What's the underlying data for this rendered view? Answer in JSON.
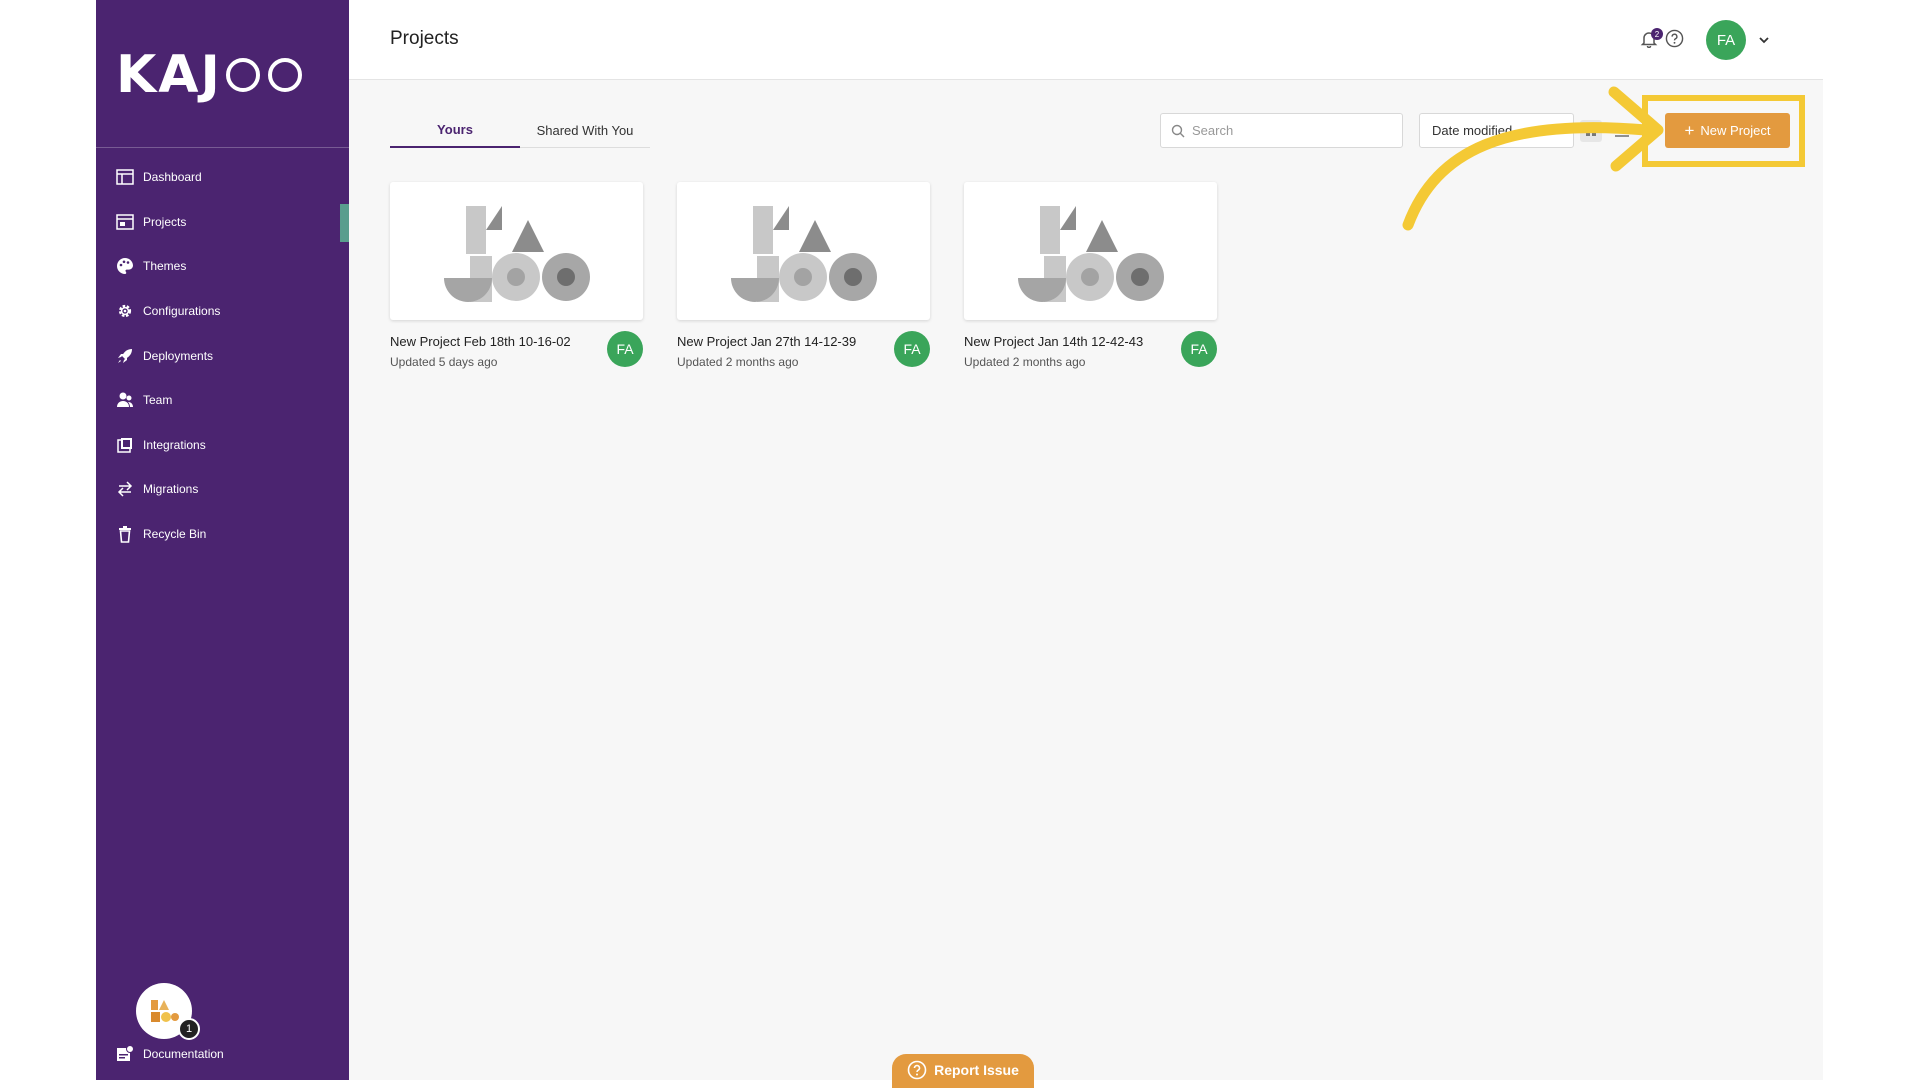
{
  "app": {
    "logo_letters": [
      "K",
      "A",
      "J"
    ],
    "page_title": "Projects"
  },
  "sidebar": {
    "items": [
      {
        "label": "Dashboard",
        "icon": "dashboard-icon"
      },
      {
        "label": "Projects",
        "icon": "projects-icon",
        "active": true
      },
      {
        "label": "Themes",
        "icon": "palette-icon"
      },
      {
        "label": "Configurations",
        "icon": "gear-icon"
      },
      {
        "label": "Deployments",
        "icon": "rocket-icon"
      },
      {
        "label": "Team",
        "icon": "team-icon"
      },
      {
        "label": "Integrations",
        "icon": "integrations-icon"
      },
      {
        "label": "Migrations",
        "icon": "migrate-arrows-icon"
      },
      {
        "label": "Recycle Bin",
        "icon": "trash-icon"
      }
    ],
    "doc_badge_count": "1",
    "documentation_label": "Documentation"
  },
  "header": {
    "notification_count": "2",
    "user_initials": "FA"
  },
  "toolbar": {
    "tabs": [
      {
        "label": "Yours",
        "active": true
      },
      {
        "label": "Shared With You",
        "active": false
      }
    ],
    "search_placeholder": "Search",
    "sort_value": "Date modified",
    "new_project_label": "New Project"
  },
  "projects": [
    {
      "name": "New Project Feb 18th 10-16-02",
      "updated": "Updated 5 days ago",
      "owner": "FA"
    },
    {
      "name": "New Project Jan 27th 14-12-39",
      "updated": "Updated 2 months ago",
      "owner": "FA"
    },
    {
      "name": "New Project Jan 14th 12-42-43",
      "updated": "Updated 2 months ago",
      "owner": "FA"
    }
  ],
  "footer": {
    "report_issue_label": "Report Issue"
  },
  "colors": {
    "sidebar_bg": "#4b2470",
    "accent_orange": "#e39a3f",
    "highlight_yellow": "#f4c935",
    "avatar_green": "#3aa55a",
    "active_marker": "#5a9e8e"
  }
}
